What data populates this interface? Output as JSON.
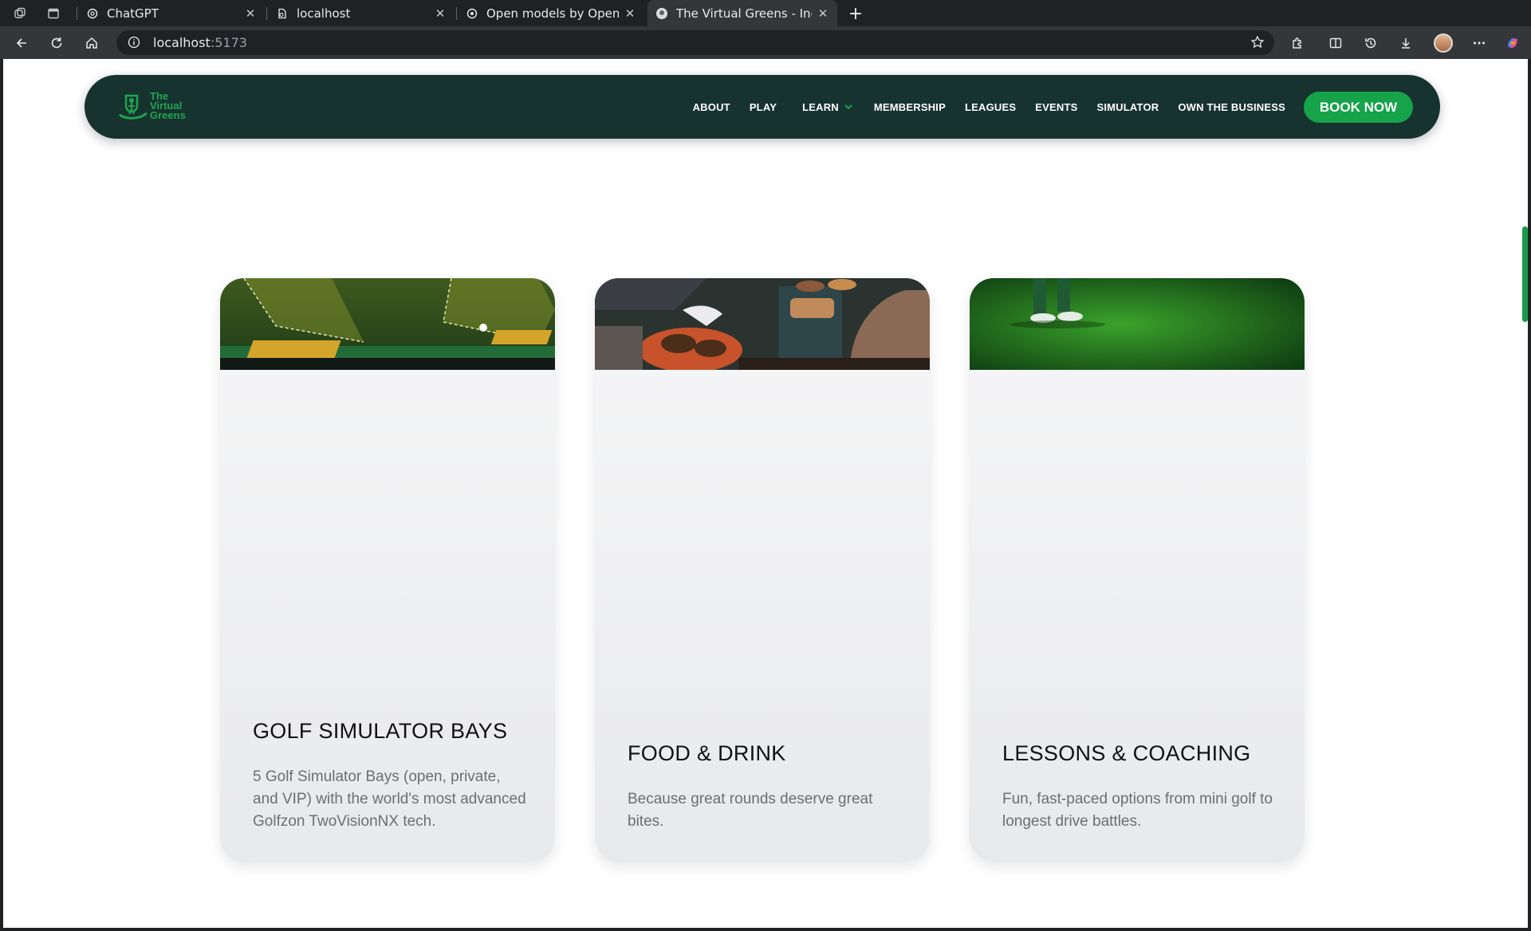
{
  "browser": {
    "tabs": [
      {
        "title": "ChatGPT",
        "icon": "chatgpt-icon"
      },
      {
        "title": "localhost",
        "icon": "page-icon"
      },
      {
        "title": "Open models by OpenAI | ",
        "icon": "openai-icon"
      },
      {
        "title": "The Virtual Greens - Indoor",
        "icon": "virtual-greens-icon",
        "active": true
      }
    ],
    "address": {
      "host": "localhost",
      "port": ":5173"
    }
  },
  "site": {
    "logo": {
      "line1": "The",
      "line2": "Virtual",
      "line3": "Greens"
    },
    "nav": [
      "ABOUT",
      "PLAY",
      "LEARN",
      "MEMBERSHIP",
      "LEAGUES",
      "EVENTS",
      "SIMULATOR",
      "OWN THE BUSINESS"
    ],
    "book_label": "BOOK NOW"
  },
  "cards": [
    {
      "title": "GOLF SIMULATOR BAYS",
      "body": "5 Golf Simulator Bays (open, private, and VIP) with the world's most advanced Golfzon TwoVisionNX tech."
    },
    {
      "title": "FOOD & DRINK",
      "body": "Because great rounds deserve great bites."
    },
    {
      "title": "LESSONS & COACHING",
      "body": "Fun, fast-paced options from mini golf to longest drive battles."
    }
  ],
  "colors": {
    "nav_bg": "#173330",
    "accent": "#16a34a"
  }
}
